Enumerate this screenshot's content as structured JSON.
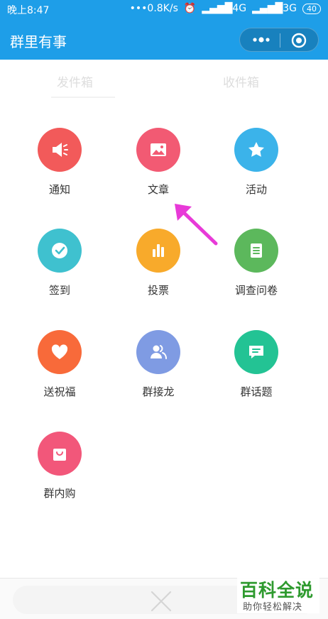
{
  "status_bar": {
    "time": "晚上8:47",
    "network_speed": "•••0.8K/s",
    "signal_1": "4G",
    "signal_2": "3G",
    "battery": "40"
  },
  "app_bar": {
    "title": "群里有事"
  },
  "tabs": [
    {
      "label": "发件箱"
    },
    {
      "label": "收件箱"
    }
  ],
  "menu": [
    {
      "label": "通知",
      "icon": "megaphone-icon",
      "color": "#f25a5a"
    },
    {
      "label": "文章",
      "icon": "image-icon",
      "color": "#f25a73"
    },
    {
      "label": "活动",
      "icon": "star-icon",
      "color": "#3bb3ea"
    },
    {
      "label": "签到",
      "icon": "check-icon",
      "color": "#3fc1cf"
    },
    {
      "label": "投票",
      "icon": "bar-chart-icon",
      "color": "#f8aa2b"
    },
    {
      "label": "调查问卷",
      "icon": "document-icon",
      "color": "#5cb85c"
    },
    {
      "label": "送祝福",
      "icon": "heart-icon",
      "color": "#f86a3a"
    },
    {
      "label": "群接龙",
      "icon": "people-icon",
      "color": "#7f9be3"
    },
    {
      "label": "群话题",
      "icon": "chat-icon",
      "color": "#23c394"
    },
    {
      "label": "群内购",
      "icon": "shopping-bag-icon",
      "color": "#f2577a"
    }
  ],
  "watermark": {
    "brand": "百科全说",
    "tagline": "助你轻松解决"
  },
  "colors": {
    "header_bg": "#1e9ee8",
    "arrow": "#e83ad8"
  }
}
